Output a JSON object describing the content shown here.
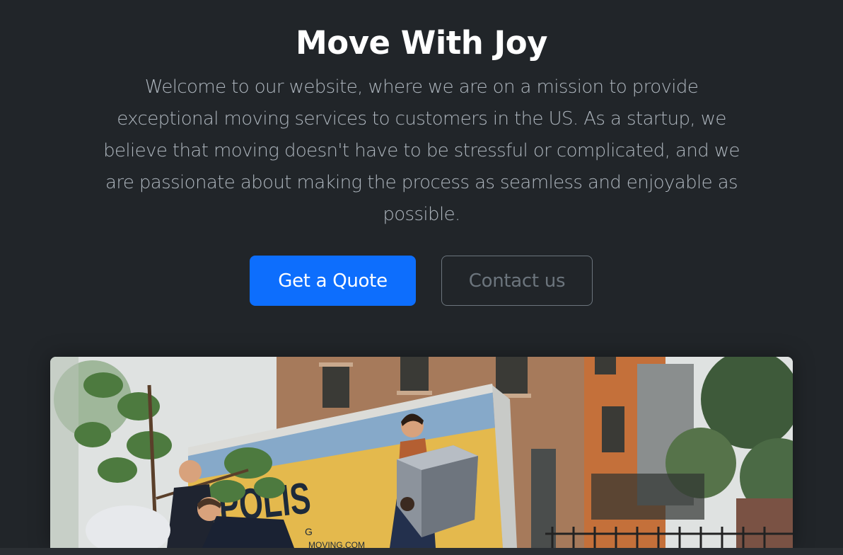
{
  "hero": {
    "title": "Move With Joy",
    "lead": "Welcome to our website, where we are on a mission to provide exceptional moving services to customers in the US. As a startup, we believe that moving doesn't have to be stressful or complicated, and we are passionate about making the process as seamless and enjoyable as possible.",
    "primary_button": "Get a Quote",
    "secondary_button": "Contact us"
  },
  "image": {
    "truck_text": "OPOLIS",
    "truck_subtext": "G",
    "truck_url": "MOVING.COM"
  },
  "colors": {
    "background": "#212529",
    "primary": "#0d6efd",
    "muted": "#6c757d",
    "lead_text": "#adb5bd"
  }
}
